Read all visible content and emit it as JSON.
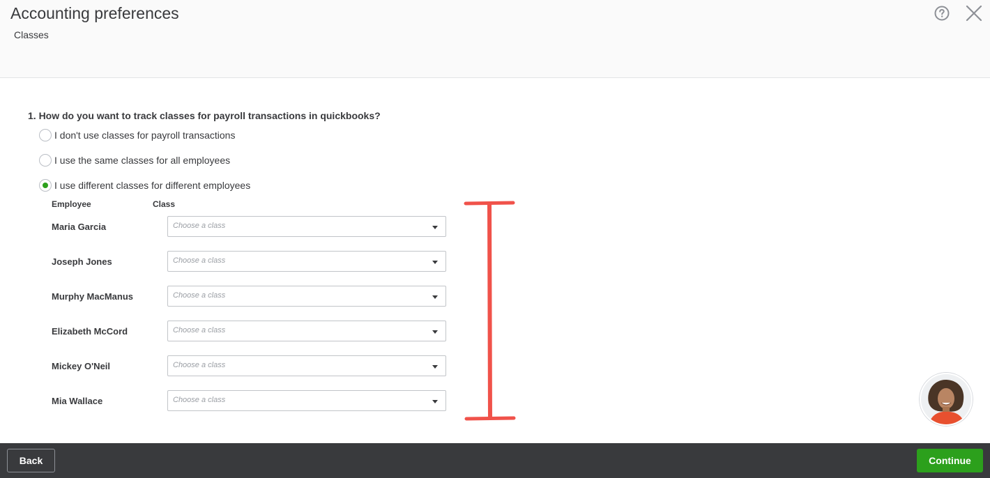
{
  "header": {
    "title": "Accounting preferences",
    "subtitle": "Classes",
    "help_icon": "help-circle-icon",
    "close_icon": "close-icon"
  },
  "question": {
    "text": "1. How do you want to track classes for payroll transactions in quickbooks?",
    "options": [
      {
        "label": "I don't use classes for payroll transactions",
        "selected": false
      },
      {
        "label": "I use the same classes for all employees",
        "selected": false
      },
      {
        "label": "I use different classes for different employees",
        "selected": true
      }
    ]
  },
  "table": {
    "employee_header": "Employee",
    "class_header": "Class",
    "rows": [
      {
        "name": "Maria Garcia",
        "placeholder": "Choose a class"
      },
      {
        "name": "Joseph Jones",
        "placeholder": "Choose a class"
      },
      {
        "name": "Murphy MacManus",
        "placeholder": "Choose a class"
      },
      {
        "name": "Elizabeth McCord",
        "placeholder": "Choose a class"
      },
      {
        "name": "Mickey O'Neil",
        "placeholder": "Choose a class"
      },
      {
        "name": "Mia Wallace",
        "placeholder": "Choose a class"
      }
    ]
  },
  "footer": {
    "back_label": "Back",
    "continue_label": "Continue"
  },
  "colors": {
    "accent_green": "#2ca01c",
    "footer_bg": "#393a3d",
    "annotation_red": "#f0524a"
  }
}
